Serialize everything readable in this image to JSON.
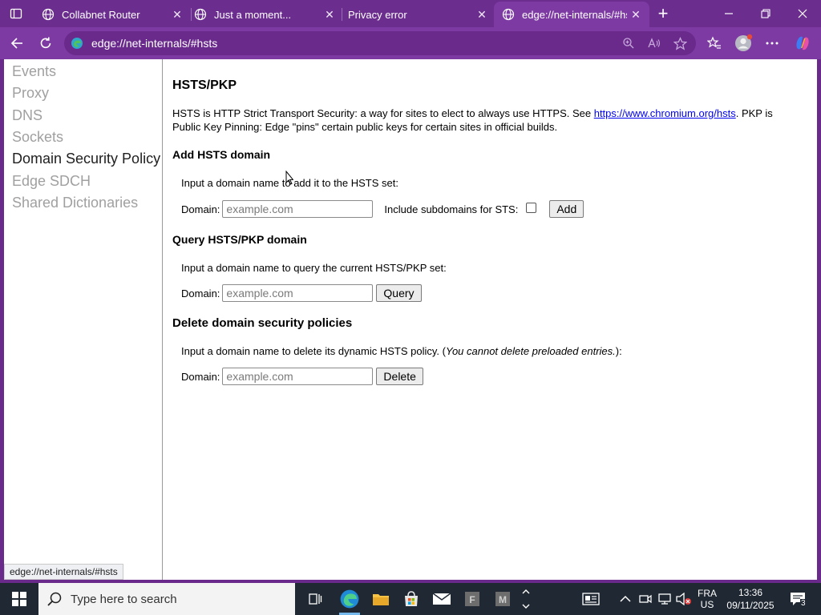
{
  "browser": {
    "tabs": [
      {
        "title": "Collabnet Router",
        "active": false
      },
      {
        "title": "Just a moment...",
        "active": false
      },
      {
        "title": "Privacy error",
        "active": false
      },
      {
        "title": "edge://net-internals/#hsts",
        "active": true
      }
    ],
    "address": "edge://net-internals/#hsts",
    "status_url": "edge://net-internals/#hsts",
    "accent_color": "#7d3aa3"
  },
  "sidebar": {
    "items": [
      {
        "label": "Events"
      },
      {
        "label": "Proxy"
      },
      {
        "label": "DNS"
      },
      {
        "label": "Sockets"
      },
      {
        "label": "Domain Security Policy",
        "selected": true
      },
      {
        "label": "Edge SDCH"
      },
      {
        "label": "Shared Dictionaries"
      }
    ]
  },
  "content": {
    "title": "HSTS/PKP",
    "intro_before": "HSTS is HTTP Strict Transport Security: a way for sites to elect to always use HTTPS. See ",
    "intro_link": "https://www.chromium.org/hsts",
    "intro_after": ". PKP is Public Key Pinning: Edge \"pins\" certain public keys for certain sites in official builds.",
    "add": {
      "heading": "Add HSTS domain",
      "instruction": "Input a domain name to add it to the HSTS set:",
      "domain_label": "Domain:",
      "placeholder": "example.com",
      "subdomains_label": "Include subdomains for STS:",
      "button": "Add"
    },
    "query": {
      "heading": "Query HSTS/PKP domain",
      "instruction": "Input a domain name to query the current HSTS/PKP set:",
      "domain_label": "Domain:",
      "placeholder": "example.com",
      "button": "Query"
    },
    "delete": {
      "heading": "Delete domain security policies",
      "instruction_before": "Input a domain name to delete its dynamic HSTS policy. (",
      "instruction_italic": "You cannot delete preloaded entries.",
      "instruction_after": "):",
      "domain_label": "Domain:",
      "placeholder": "example.com",
      "button": "Delete"
    }
  },
  "taskbar": {
    "search_placeholder": "Type here to search",
    "lang_top": "FRA",
    "lang_bottom": "US",
    "time": "13:36",
    "date": "09/11/2025",
    "notification_count": "3"
  }
}
